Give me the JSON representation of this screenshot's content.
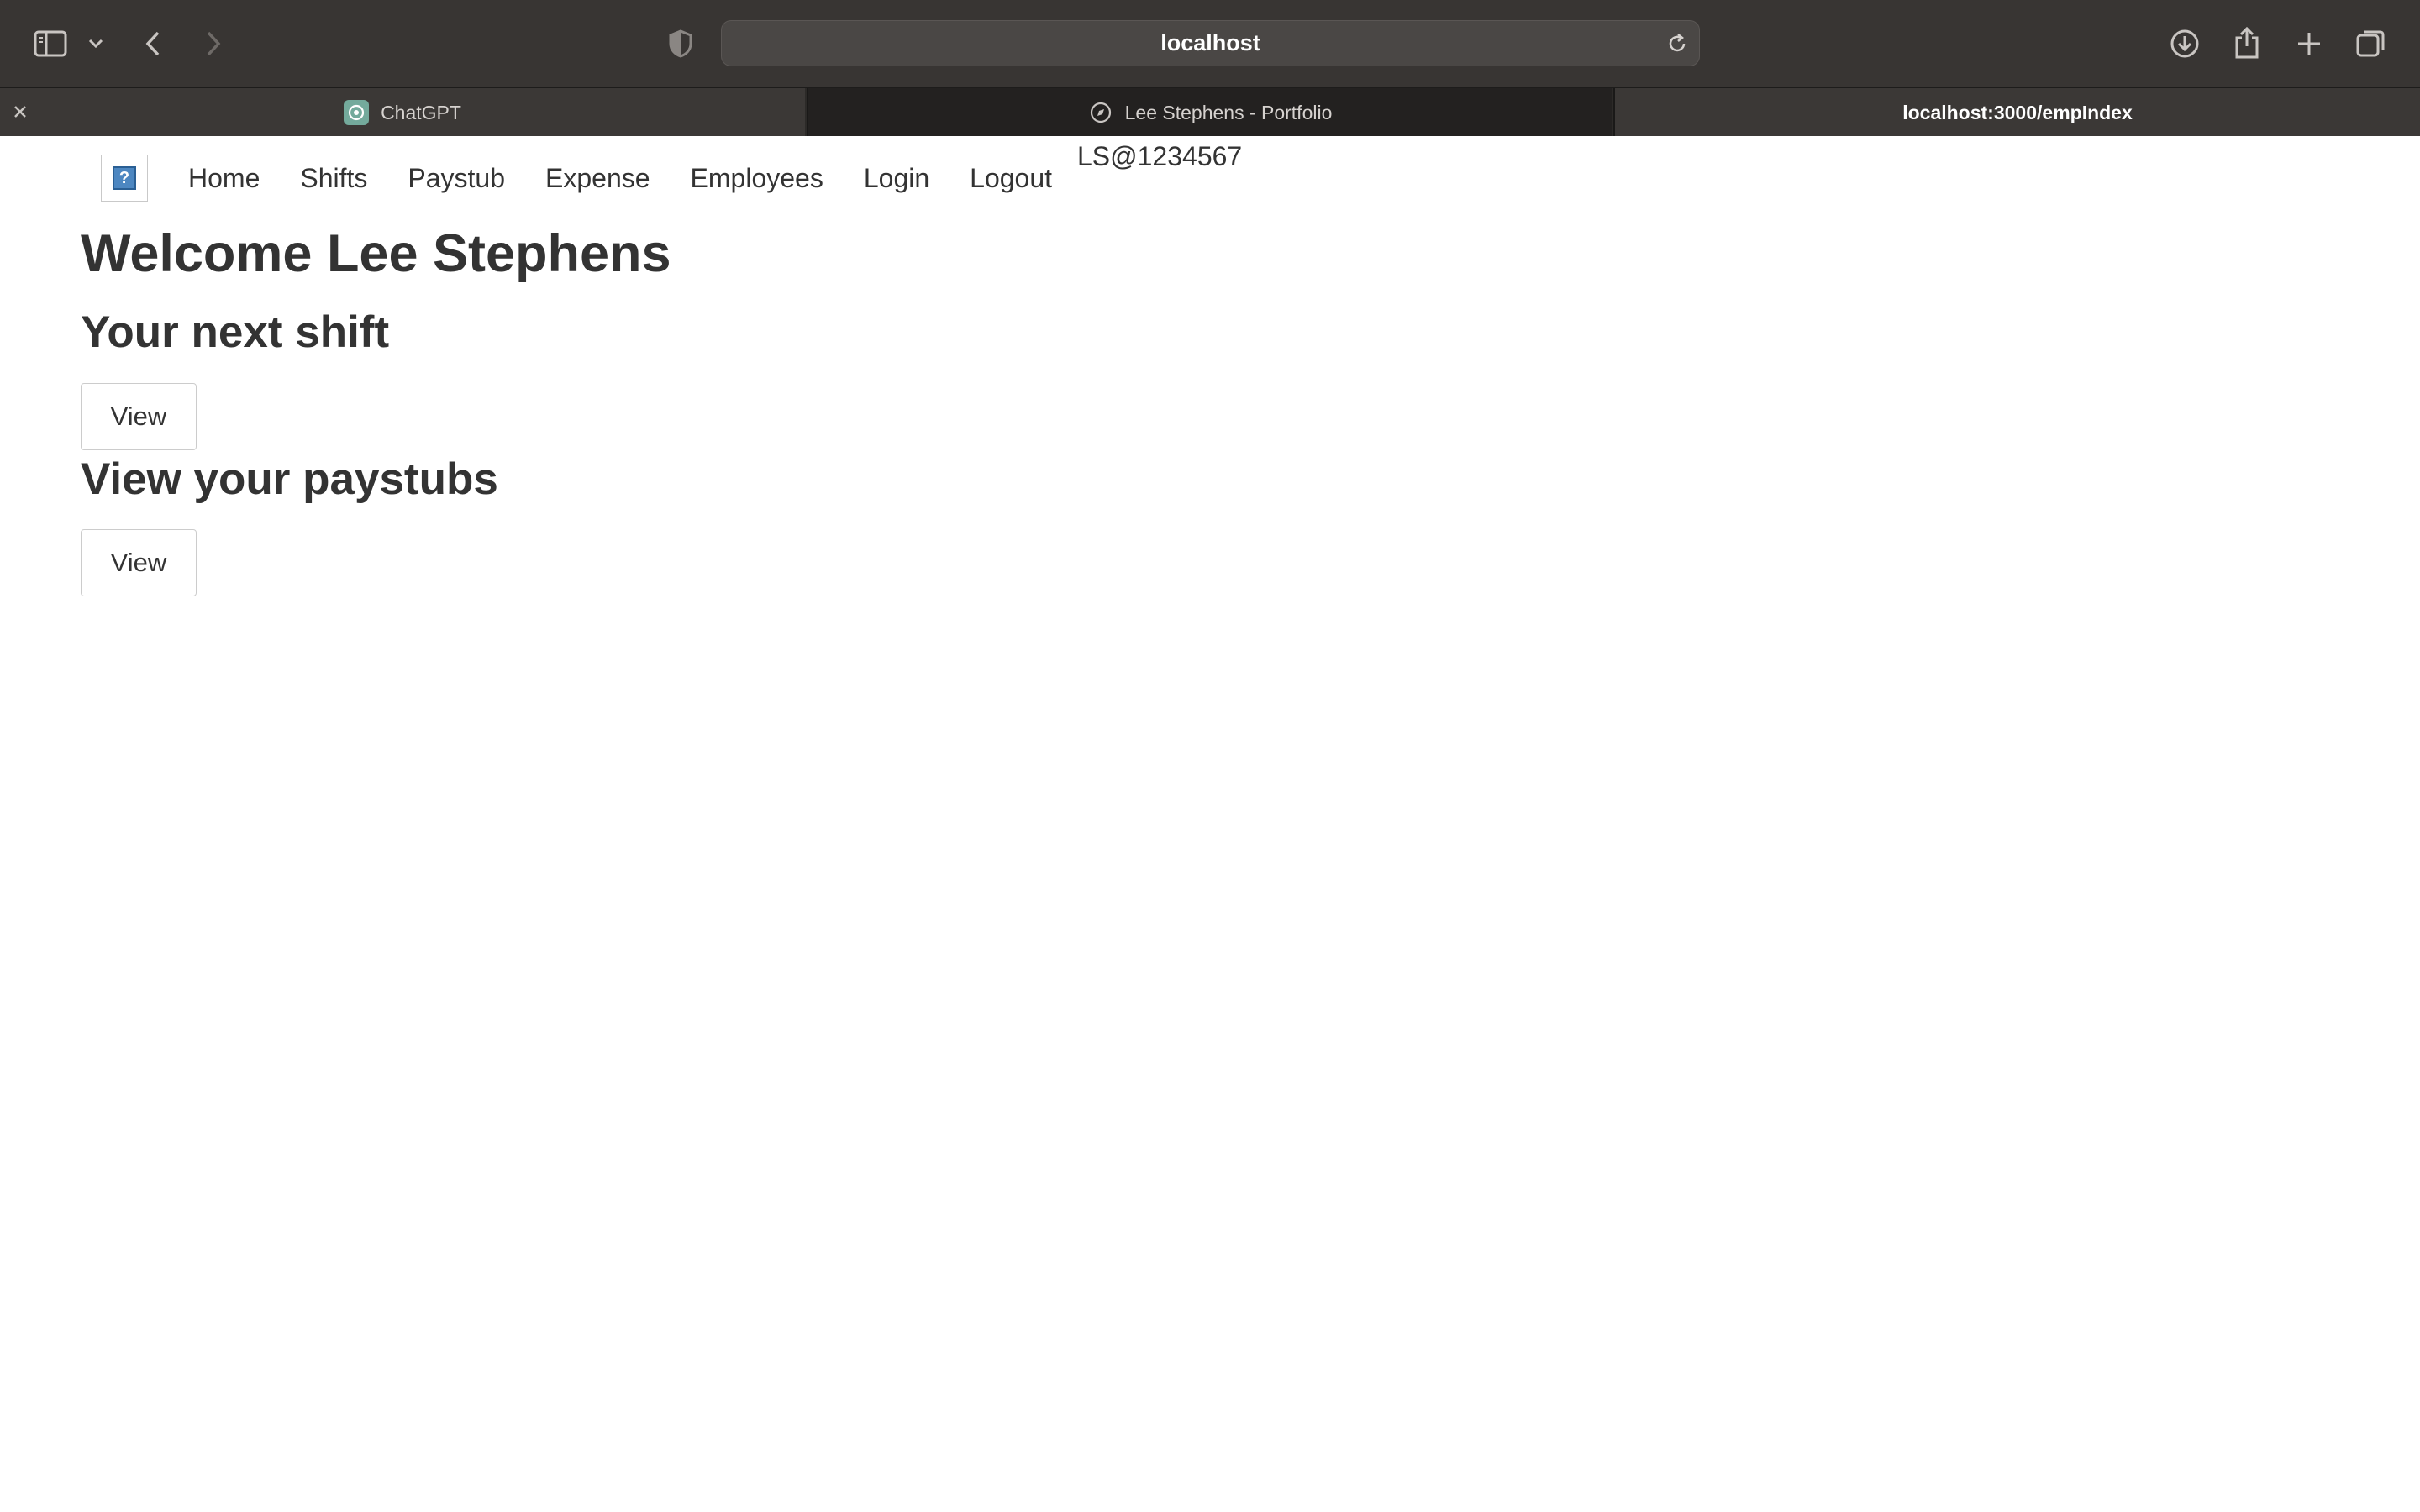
{
  "browser": {
    "address": "localhost",
    "tabs": [
      {
        "label": "ChatGPT"
      },
      {
        "label": "Lee Stephens - Portfolio"
      },
      {
        "label": "localhost:3000/empIndex"
      }
    ]
  },
  "nav": {
    "logo_glyph": "?",
    "items": [
      "Home",
      "Shifts",
      "Paystub",
      "Expense",
      "Employees",
      "Login",
      "Logout"
    ],
    "user_id": "LS@1234567"
  },
  "main": {
    "welcome": "Welcome Lee Stephens",
    "next_shift_heading": "Your next shift",
    "next_shift_button": "View",
    "paystubs_heading": "View your paystubs",
    "paystubs_button": "View"
  },
  "colors": {
    "toolbar_bg": "#383533",
    "tabbar_bg": "#2c2a28",
    "text": "#333333"
  }
}
